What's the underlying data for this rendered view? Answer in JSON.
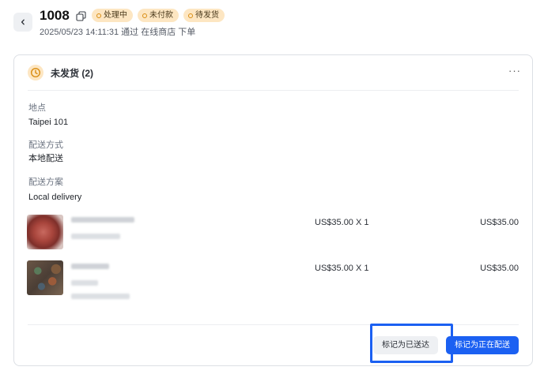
{
  "header": {
    "order_number": "1008",
    "subtitle": "2025/05/23 14:11:31 通过 在线商店 下单",
    "badges": [
      {
        "label": "处理中"
      },
      {
        "label": "未付款"
      },
      {
        "label": "待发货"
      }
    ]
  },
  "card": {
    "title": "未发货 (2)",
    "more_label": "···",
    "fields": {
      "location_label": "地点",
      "location_value": "Taipei 101",
      "shipping_method_label": "配送方式",
      "shipping_method_value": "本地配送",
      "shipping_plan_label": "配送方案",
      "shipping_plan_value": "Local delivery"
    },
    "items": [
      {
        "unit_price": "US$35.00 X 1",
        "total": "US$35.00"
      },
      {
        "unit_price": "US$35.00 X 1",
        "total": "US$35.00"
      }
    ],
    "actions": {
      "mark_delivered": "标记为已送达",
      "mark_delivering": "标记为正在配送"
    }
  },
  "colors": {
    "badge_bg": "#fde6c2",
    "badge_dot": "#d98d12",
    "primary": "#1b60f2",
    "highlight": "#1b60f2"
  },
  "icons": {
    "back": "chevron-left-icon",
    "copy": "copy-icon",
    "status": "clock-icon",
    "more": "more-horizontal-icon"
  }
}
